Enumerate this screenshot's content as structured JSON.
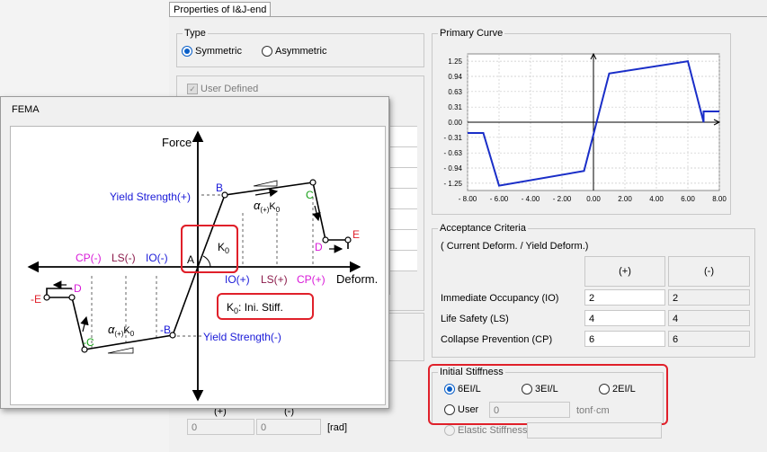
{
  "tab": {
    "label": "Properties of I&J-end"
  },
  "type_group": {
    "title": "Type",
    "symmetric": "Symmetric",
    "asymmetric": "Asymmetric",
    "selected": "Symmetric"
  },
  "user_defined": {
    "label": "User Defined"
  },
  "primary_curve": {
    "title": "Primary Curve"
  },
  "chart_data": {
    "type": "line",
    "x": [
      -8.0,
      -7.0,
      -6.0,
      -0.6,
      1.0,
      6.0,
      7.0,
      7.0,
      8.0
    ],
    "y": [
      -0.22,
      -0.22,
      -1.3,
      -1.0,
      1.0,
      1.25,
      -0.0,
      0.22,
      0.22
    ],
    "xticks": [
      "- 8.00",
      "- 6.00",
      "- 4.00",
      "- 2.00",
      "0.00",
      "2.00",
      "4.00",
      "6.00",
      "8.00"
    ],
    "yticks": [
      "1.25",
      "0.94",
      "0.63",
      "0.31",
      "0.00",
      "- 0.31",
      "- 0.63",
      "- 0.94",
      "- 1.25"
    ],
    "xlim": [
      -8,
      8
    ],
    "ylim": [
      -1.4,
      1.4
    ],
    "grid": true
  },
  "acceptance": {
    "title": "Acceptance Criteria",
    "subtitle": "( Current Deform. / Yield Deform.)",
    "col_pos": "(+)",
    "col_neg": "(-)",
    "rows": [
      {
        "label": "Immediate Occupancy (IO)",
        "pos": "2",
        "neg": "2"
      },
      {
        "label": "Life Safety (LS)",
        "pos": "4",
        "neg": "4"
      },
      {
        "label": "Collapse Prevention (CP)",
        "pos": "6",
        "neg": "6"
      }
    ]
  },
  "stiffness": {
    "title": "Initial Stiffness",
    "opt1": "6EI/L",
    "opt2": "3EI/L",
    "opt3": "2EI/L",
    "opt4": "User",
    "user_value": "0",
    "unit": "tonf·cm",
    "selected": "6EI/L",
    "elastic": "Elastic Stiffness :"
  },
  "bottom": {
    "col_pos": "(+)",
    "col_neg": "(-)",
    "val_pos": "0",
    "val_neg": "0",
    "unit": "[rad]"
  },
  "fema": {
    "title": "FEMA",
    "force": "Force",
    "deform": "Deform.",
    "yield_pos": "Yield Strength(+)",
    "yield_neg": "Yield Strength(-)",
    "pt_A": "A",
    "pt_B": "B",
    "pt_C": "C",
    "pt_D": "D",
    "pt_E": "E",
    "pt_nB": "-B",
    "pt_nC": "-C",
    "pt_nD": "-D",
    "pt_nE": "-E",
    "io_pos": "IO(+)",
    "ls_pos": "LS(+)",
    "cp_pos": "CP(+)",
    "io_neg": "IO(-)",
    "ls_neg": "LS(-)",
    "cp_neg": "CP(-)",
    "k0": "K",
    "k0_sub": "0",
    "k0_note_a": "K",
    "k0_note_sub": "0",
    "k0_note_b": ": Ini.  Stiff.",
    "alpha_pos_a": "α",
    "alpha_pos_sub": "(+)",
    "alpha_pos_b": "K",
    "alpha_pos_sub2": "0",
    "alpha_neg_a": "α",
    "alpha_neg_sub": "(+)",
    "alpha_neg_b": "K",
    "alpha_neg_sub2": "0"
  }
}
